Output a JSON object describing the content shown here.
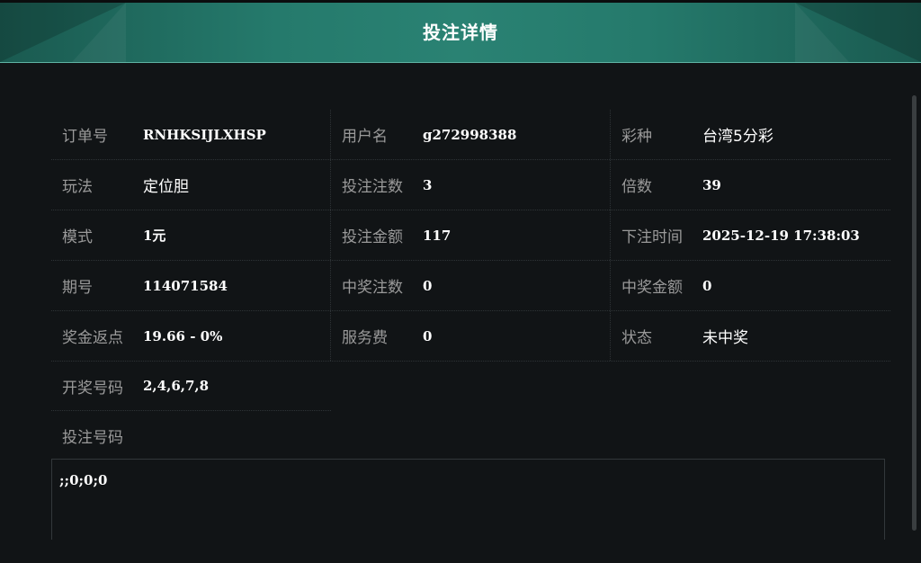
{
  "header": {
    "title": "投注详情"
  },
  "rows": [
    [
      {
        "label": "订单号",
        "value": "RNHKSIJLXHSP"
      },
      {
        "label": "用户名",
        "value": "g272998388"
      },
      {
        "label": "彩种",
        "value": "台湾5分彩"
      }
    ],
    [
      {
        "label": "玩法",
        "value": "定位胆"
      },
      {
        "label": "投注注数",
        "value": "3"
      },
      {
        "label": "倍数",
        "value": "39"
      }
    ],
    [
      {
        "label": "模式",
        "value": "1元"
      },
      {
        "label": "投注金额",
        "value": "117"
      },
      {
        "label": "下注时间",
        "value": "2025-12-19 17:38:03"
      }
    ],
    [
      {
        "label": "期号",
        "value": "114071584"
      },
      {
        "label": "中奖注数",
        "value": "0"
      },
      {
        "label": "中奖金额",
        "value": "0"
      }
    ],
    [
      {
        "label": "奖金返点",
        "value": "19.66 - 0%"
      },
      {
        "label": "服务费",
        "value": "0"
      },
      {
        "label": "状态",
        "value": "未中奖"
      }
    ],
    [
      {
        "label": "开奖号码",
        "value": "2,4,6,7,8"
      }
    ]
  ],
  "bet_numbers": {
    "label": "投注号码",
    "value": ";;0;0;0"
  }
}
